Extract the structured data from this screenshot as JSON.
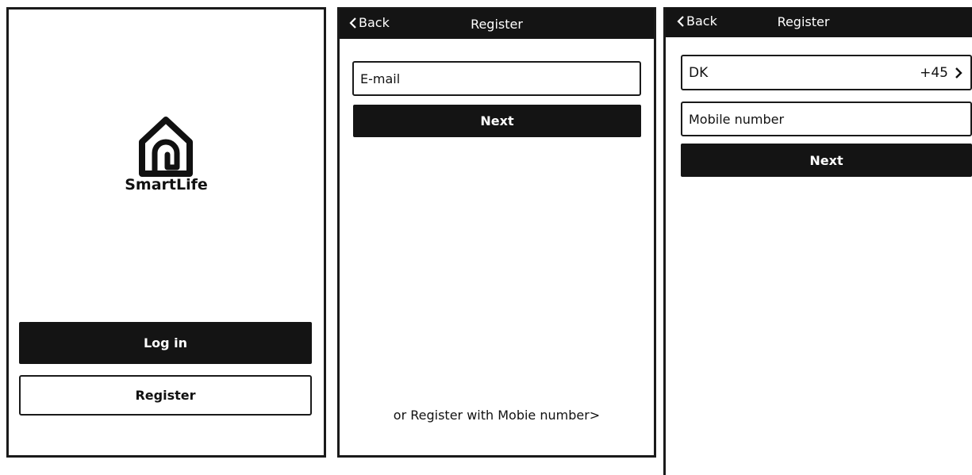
{
  "screen1": {
    "brand": "SmartLife",
    "login_label": "Log in",
    "register_label": "Register"
  },
  "screen2": {
    "back_label": "Back",
    "title": "Register",
    "email_placeholder": "E-mail",
    "next_label": "Next",
    "alt_link": "or Register with Mobie number>"
  },
  "screen3": {
    "back_label": "Back",
    "title": "Register",
    "country": "DK",
    "dial_code": "+45",
    "mobile_placeholder": "Mobile number",
    "next_label": "Next"
  },
  "icons": {
    "logo": "house-logo-icon",
    "back": "chevron-left-icon",
    "country_arrow": "chevron-right-icon"
  },
  "colors": {
    "bar": "#141414",
    "border": "#1a1a1a",
    "background": "#ffffff"
  }
}
